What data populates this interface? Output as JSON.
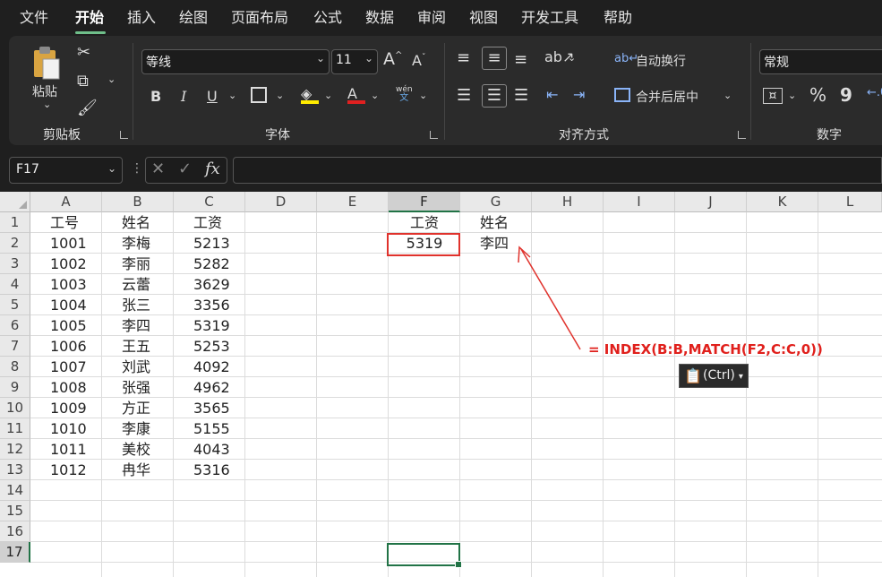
{
  "tabs": [
    "文件",
    "开始",
    "插入",
    "绘图",
    "页面布局",
    "公式",
    "数据",
    "审阅",
    "视图",
    "开发工具",
    "帮助"
  ],
  "active_tab": "开始",
  "ribbon": {
    "clipboard": {
      "paste_label": "粘贴",
      "group_label": "剪贴板"
    },
    "font": {
      "font_name": "等线",
      "font_size": "11",
      "group_label": "字体",
      "phonetic": "wén\n文"
    },
    "align": {
      "wrap_label": "自动换行",
      "merge_label": "合并后居中",
      "group_label": "对齐方式"
    },
    "number": {
      "format": "常规",
      "group_label": "数字",
      "percent": "%",
      "comma": "9"
    }
  },
  "formula_bar": {
    "name_box": "F17",
    "fx": "fx",
    "formula": ""
  },
  "columns": [
    "A",
    "B",
    "C",
    "D",
    "E",
    "F",
    "G",
    "H",
    "I",
    "J",
    "K",
    "L"
  ],
  "rows": [
    "1",
    "2",
    "3",
    "4",
    "5",
    "6",
    "7",
    "8",
    "9",
    "10",
    "11",
    "12",
    "13",
    "14",
    "15",
    "16",
    "17"
  ],
  "table": {
    "headers": [
      "工号",
      "姓名",
      "工资"
    ],
    "rows": [
      [
        "1001",
        "李梅",
        "5213"
      ],
      [
        "1002",
        "李丽",
        "5282"
      ],
      [
        "1003",
        "云蕾",
        "3629"
      ],
      [
        "1004",
        "张三",
        "3356"
      ],
      [
        "1005",
        "李四",
        "5319"
      ],
      [
        "1006",
        "王五",
        "5253"
      ],
      [
        "1007",
        "刘武",
        "4092"
      ],
      [
        "1008",
        "张强",
        "4962"
      ],
      [
        "1009",
        "方正",
        "3565"
      ],
      [
        "1010",
        "李康",
        "5155"
      ],
      [
        "1011",
        "美校",
        "4043"
      ],
      [
        "1012",
        "冉华",
        "5316"
      ]
    ]
  },
  "lookup": {
    "f1": "工资",
    "g1": "姓名",
    "f2": "5319",
    "g2": "李四"
  },
  "annotation": "= INDEX(B:B,MATCH(F2,C:C,0))",
  "paste_options": "(Ctrl)",
  "colors": {
    "annotation": "#e0201c",
    "selection": "#217346",
    "ribbon_bg": "#2b2b2b"
  }
}
